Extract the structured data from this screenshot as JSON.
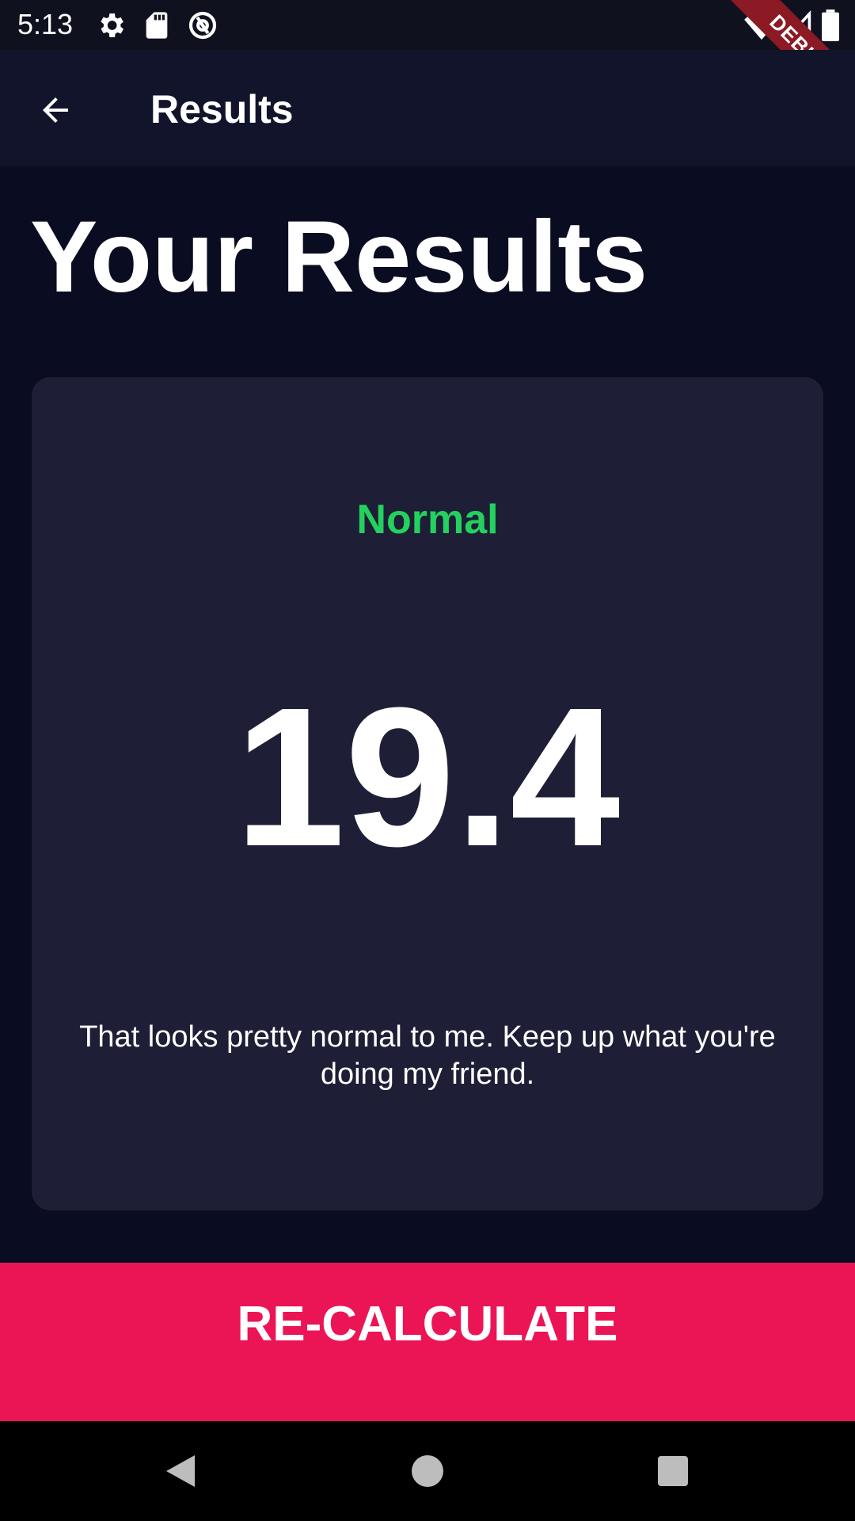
{
  "status_bar": {
    "time": "5:13",
    "icons": [
      "gear-icon",
      "sd-card-icon",
      "at-sign-icon",
      "wifi-icon",
      "signal-icon",
      "battery-icon"
    ],
    "debug_label": "DEBUG"
  },
  "app_bar": {
    "title": "Results",
    "back_icon": "arrow-back-icon"
  },
  "heading": "Your Results",
  "result": {
    "status": "Normal",
    "status_color": "#24d15f",
    "bmi": "19.4",
    "message": "That looks pretty normal to me. Keep up what you're doing my friend."
  },
  "recalculate_label": "RE-CALCULATE",
  "colors": {
    "background": "#0a0c21",
    "card": "#1e1f36",
    "accent": "#eb1555"
  },
  "nav_bar": {
    "icons": [
      "back-triangle-icon",
      "home-circle-icon",
      "recents-square-icon"
    ]
  }
}
